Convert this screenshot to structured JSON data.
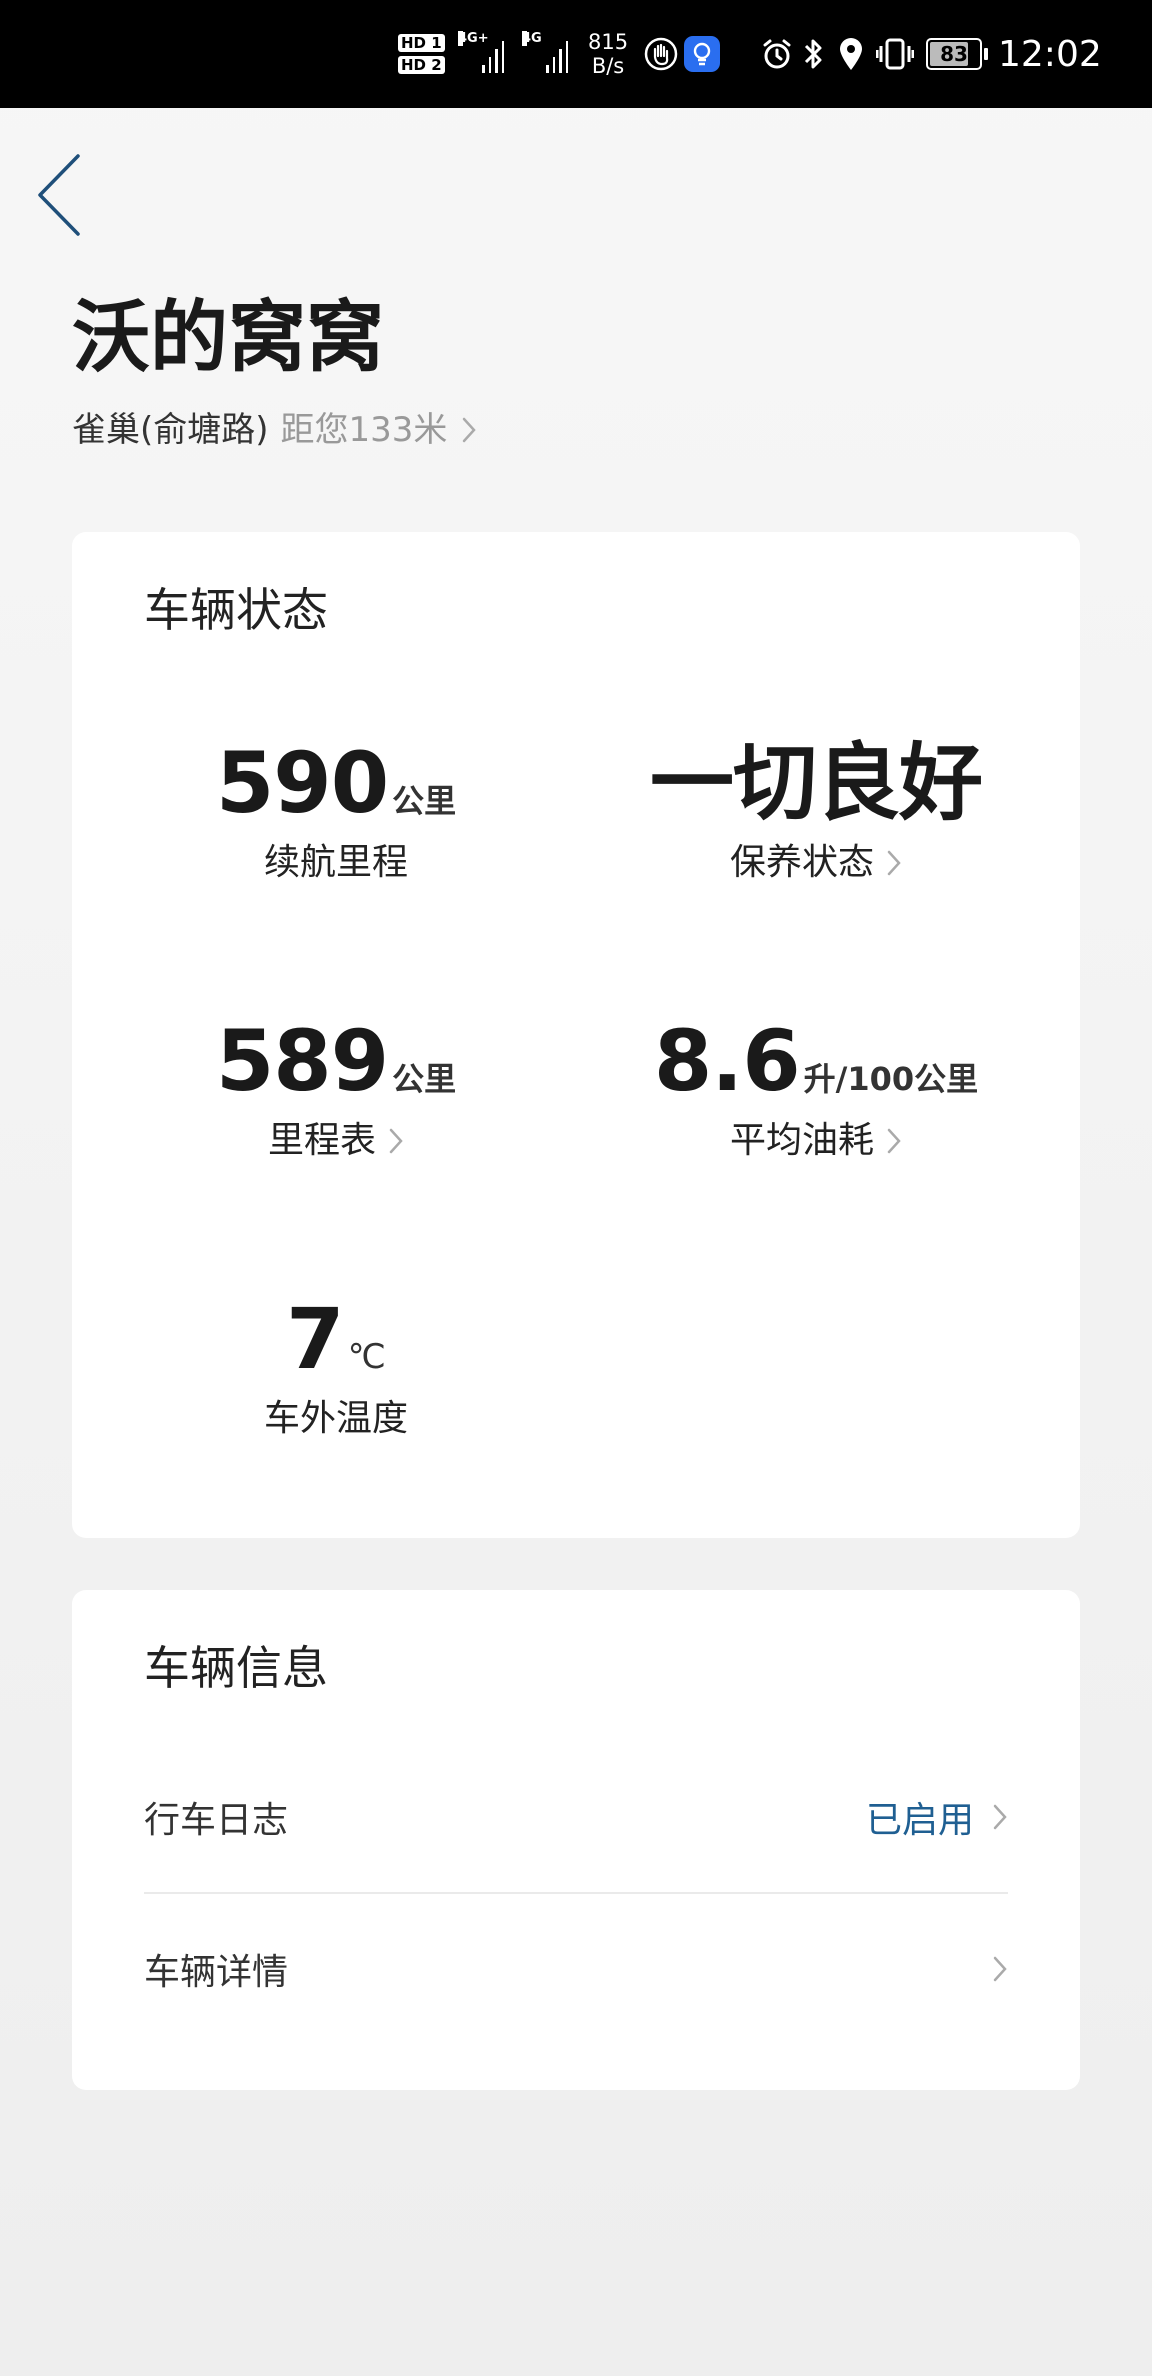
{
  "status_bar": {
    "hd1": "HD 1",
    "hd2": "HD 2",
    "sim1": "4G+",
    "sim2": "4G",
    "net_speed": "815",
    "net_unit": "B/s",
    "battery": "83",
    "time": "12:02"
  },
  "header": {
    "title": "沃的窝窝",
    "location": "雀巢(俞塘路)",
    "distance": "距您133米"
  },
  "status_card": {
    "title": "车辆状态",
    "range": {
      "value": "590",
      "unit": "公里",
      "label": "续航里程"
    },
    "maintenance": {
      "value": "一切良好",
      "label": "保养状态"
    },
    "odometer": {
      "value": "589",
      "unit": "公里",
      "label": "里程表"
    },
    "fuel": {
      "value": "8.6",
      "unit": "升/100公里",
      "label": "平均油耗"
    },
    "temperature": {
      "value": "7",
      "unit": "℃",
      "label": "车外温度"
    }
  },
  "info_card": {
    "title": "车辆信息",
    "rows": [
      {
        "label": "行车日志",
        "state": "已启用"
      },
      {
        "label": "车辆详情",
        "state": ""
      }
    ]
  },
  "colors": {
    "accent": "#1f5f92",
    "text": "#1a1a1a",
    "muted": "#999999"
  }
}
